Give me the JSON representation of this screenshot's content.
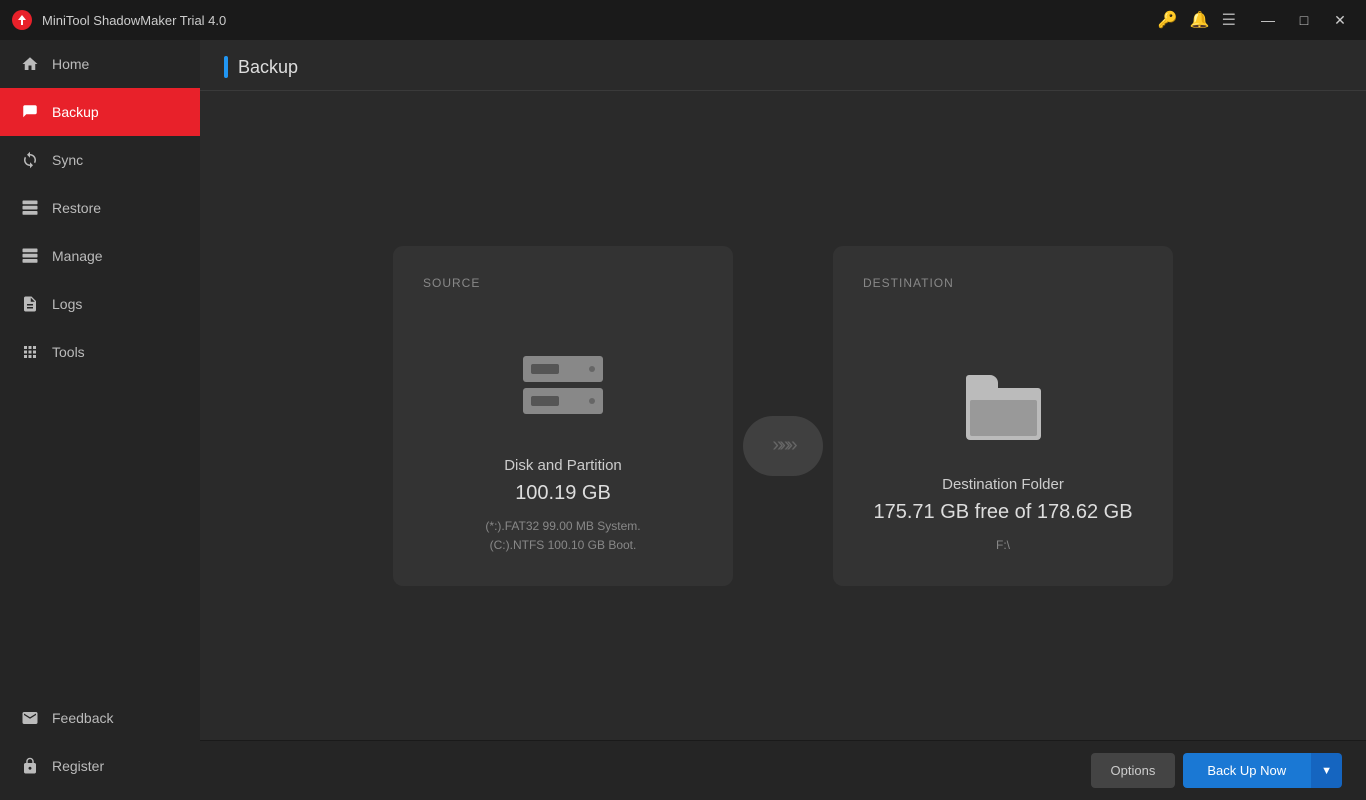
{
  "app": {
    "title": "MiniTool ShadowMaker Trial 4.0"
  },
  "titlebar": {
    "icons": [
      "key-icon",
      "bell-icon",
      "menu-icon"
    ],
    "controls": [
      "minimize",
      "maximize",
      "close"
    ]
  },
  "sidebar": {
    "items": [
      {
        "id": "home",
        "label": "Home",
        "icon": "home-icon",
        "active": false
      },
      {
        "id": "backup",
        "label": "Backup",
        "icon": "backup-icon",
        "active": true
      },
      {
        "id": "sync",
        "label": "Sync",
        "icon": "sync-icon",
        "active": false
      },
      {
        "id": "restore",
        "label": "Restore",
        "icon": "restore-icon",
        "active": false
      },
      {
        "id": "manage",
        "label": "Manage",
        "icon": "manage-icon",
        "active": false
      },
      {
        "id": "logs",
        "label": "Logs",
        "icon": "logs-icon",
        "active": false
      },
      {
        "id": "tools",
        "label": "Tools",
        "icon": "tools-icon",
        "active": false
      }
    ],
    "bottom_items": [
      {
        "id": "feedback",
        "label": "Feedback",
        "icon": "feedback-icon"
      },
      {
        "id": "register",
        "label": "Register",
        "icon": "register-icon"
      }
    ]
  },
  "page": {
    "title": "Backup"
  },
  "source_card": {
    "label": "SOURCE",
    "main_text": "Disk and Partition",
    "size": "100.19 GB",
    "detail_line1": "(*:).FAT32 99.00 MB System.",
    "detail_line2": "(C:).NTFS 100.10 GB Boot."
  },
  "destination_card": {
    "label": "DESTINATION",
    "main_text": "Destination Folder",
    "free_space": "175.71 GB free of 178.62 GB",
    "path": "F:\\"
  },
  "arrow": {
    "symbol": "»»»"
  },
  "footer": {
    "options_label": "Options",
    "backup_now_label": "Back Up Now",
    "dropdown_symbol": "▼"
  }
}
